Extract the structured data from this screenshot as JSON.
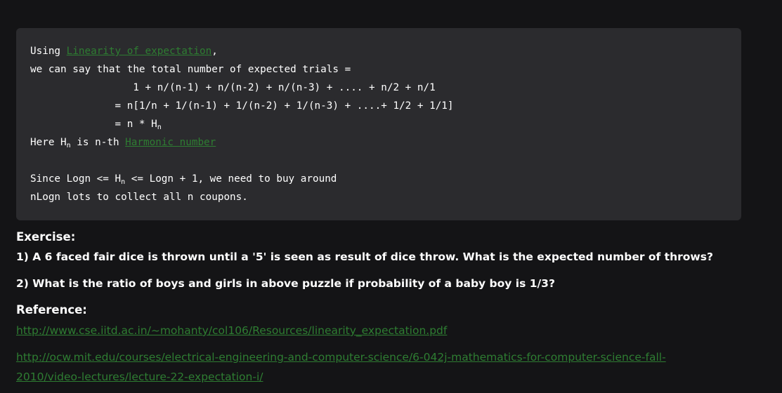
{
  "code": {
    "line1_prefix": "Using ",
    "line1_link": "Linearity of expectation",
    "line1_suffix": ",",
    "line2": "we can say that the total number of expected trials =",
    "line3": "                 1 + n/(n-1) + n/(n-2) + n/(n-3) + .... + n/2 + n/1",
    "line4": "              = n[1/n + 1/(n-1) + 1/(n-2) + 1/(n-3) + ....+ 1/2 + 1/1]",
    "line5_prefix": "              = n * H",
    "line5_sub": "n",
    "line6_prefix": "Here H",
    "line6_sub": "n",
    "line6_middle": " is n-th ",
    "line6_link": "Harmonic number",
    "line8_prefix": "Since Logn <= H",
    "line8_sub": "n",
    "line8_suffix": " <= Logn + 1, we need to buy around",
    "line9": "nLogn lots to collect all n coupons."
  },
  "exercise": {
    "heading": "Exercise:",
    "q1": "1) A 6 faced fair dice is thrown until a '5' is seen as result of dice throw. What is the expected number of throws?",
    "q2": "2) What is the ratio of boys and girls in above puzzle if probability of a baby boy is 1/3?"
  },
  "reference": {
    "heading": "Reference:",
    "link1": "http://www.cse.iitd.ac.in/~mohanty/col106/Resources/linearity_expectation.pdf",
    "link2_line1": "http://ocw.mit.edu/courses/electrical-engineering-and-computer-science/6-042j-mathematics-for-computer-science-fall-",
    "link2_line2": "2010/video-lectures/lecture-22-expectation-i/"
  },
  "colors": {
    "background": "#141416",
    "code_background": "#2b2b2e",
    "link": "#2e7d32",
    "text": "#ffffff"
  }
}
